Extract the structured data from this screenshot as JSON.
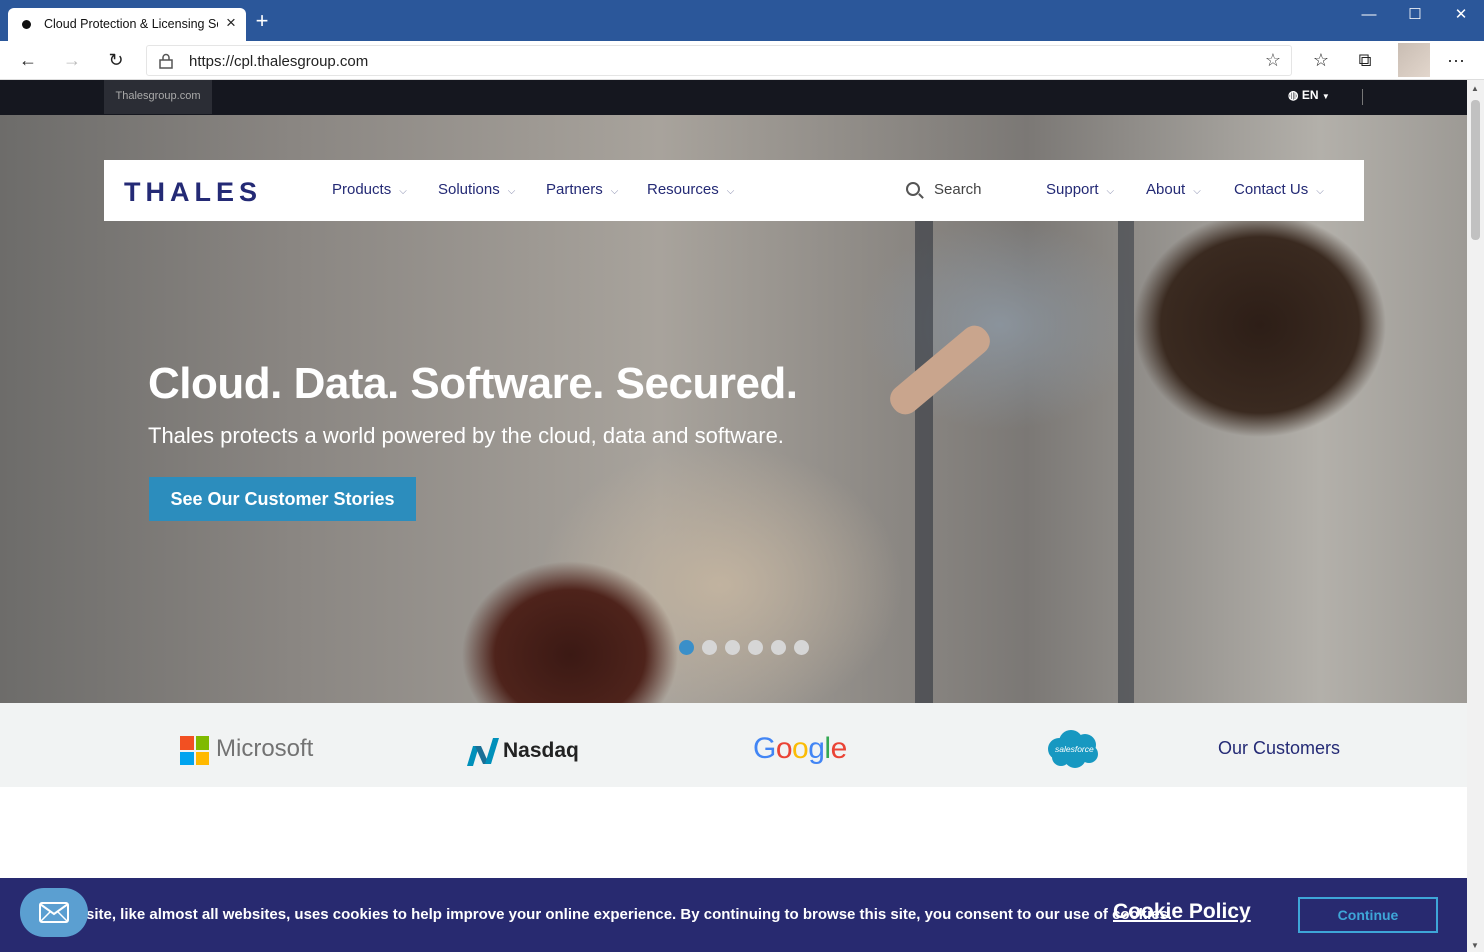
{
  "browser": {
    "tab_title": "Cloud Protection & Licensing Sol",
    "url": "https://cpl.thalesgroup.com"
  },
  "topstrip": {
    "site_link": "Thalesgroup.com",
    "language": "EN"
  },
  "nav": {
    "logo": "THALES",
    "items": [
      "Products",
      "Solutions",
      "Partners",
      "Resources"
    ],
    "search_label": "Search",
    "right_items": [
      "Support",
      "About",
      "Contact Us"
    ]
  },
  "hero": {
    "title": "Cloud. Data. Software. Secured.",
    "subtitle": "Thales protects a world powered by the cloud, data and software.",
    "cta": "See Our Customer Stories",
    "slides": 6,
    "active_slide": 1
  },
  "customers": {
    "logos": [
      "Microsoft",
      "Nasdaq",
      "Google",
      "salesforce"
    ],
    "link": "Our Customers"
  },
  "cookie": {
    "text": "site, like almost all websites, uses cookies to help improve your online experience. By continuing to browse this site, you consent to our use of cookies.",
    "policy_link": "Cookie Policy",
    "continue_label": "Continue"
  },
  "colors": {
    "brand_navy": "#242a75",
    "cta_blue": "#2c8dbd",
    "titlebar": "#2b579a",
    "cookie_bg": "#282a70"
  }
}
